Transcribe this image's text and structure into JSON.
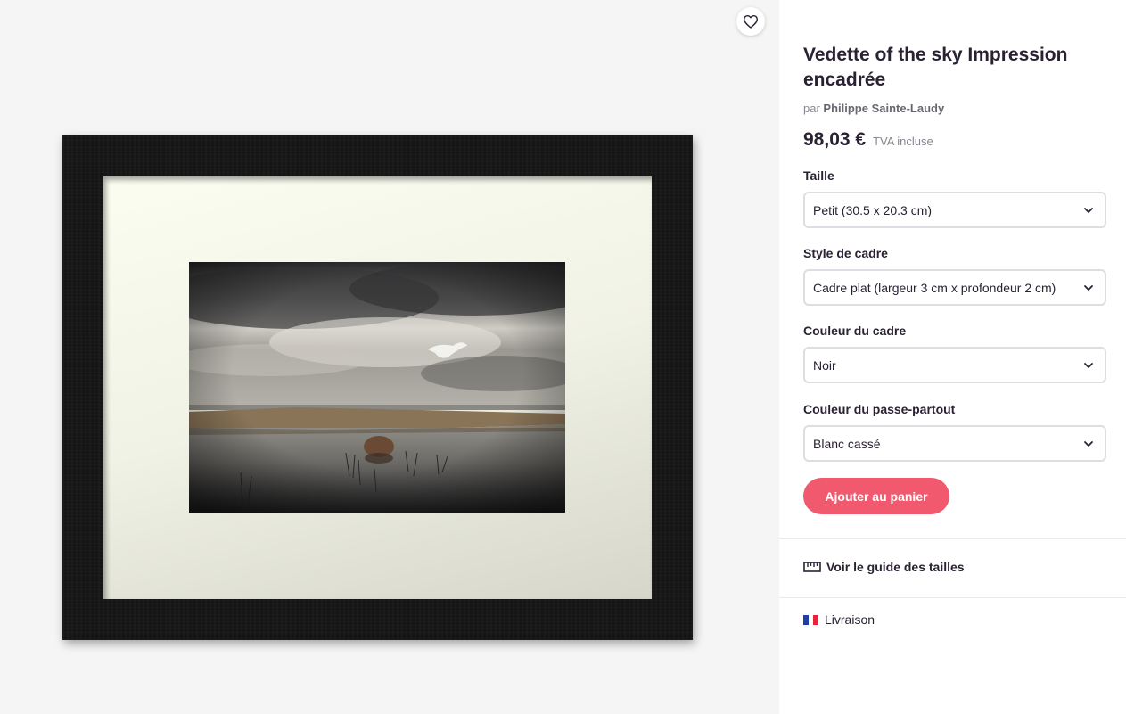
{
  "product": {
    "title": "Vedette of the sky Impression encadrée",
    "by_prefix": "par",
    "artist": "Philippe Sainte-Laudy",
    "price": "98,03 €",
    "tax_note": "TVA incluse"
  },
  "options": {
    "size": {
      "label": "Taille",
      "value": "Petit (30.5 x 20.3 cm)"
    },
    "frame_style": {
      "label": "Style de cadre",
      "value": "Cadre plat (largeur 3 cm x profondeur 2 cm)"
    },
    "frame_color": {
      "label": "Couleur du cadre",
      "value": "Noir"
    },
    "mat_color": {
      "label": "Couleur du passe-partout",
      "value": "Blanc cassé"
    }
  },
  "actions": {
    "add_to_cart": "Ajouter au panier",
    "size_guide": "Voir le guide des tailles",
    "shipping": "Livraison"
  },
  "icons": {
    "favorite": "heart-icon",
    "dropdown": "chevron-down-icon",
    "size_guide": "ruler-icon",
    "shipping": "france-flag-icon"
  },
  "colors": {
    "accent": "#f15a6e",
    "text": "#2a2233",
    "muted": "#8a8590",
    "frame": "#151515",
    "mat": "#f4f5e9"
  }
}
